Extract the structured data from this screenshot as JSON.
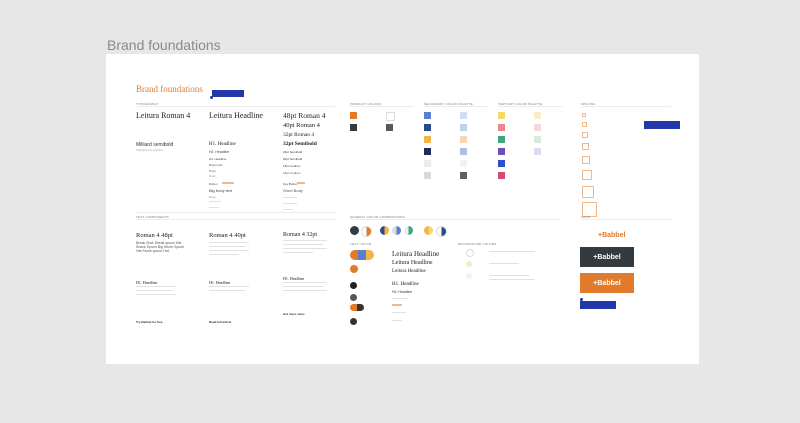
{
  "page_title": "Brand foundations",
  "board_title": "Brand foundations",
  "comment_text": "",
  "sections": {
    "typography": "TYPOGRAPHY",
    "product_colors": "PRODUCT COLORS",
    "secondary_colors": "SECONDARY COLOR PALETTE",
    "tertiary_colors": "TERTIARY COLOR PALETTE",
    "spacing": "SPACING",
    "text_components": "TEXT COMPONENTS",
    "color_combinations": "GENERAL COLOR COMBINATIONS",
    "text_color": "TEXT COLOR",
    "background_colors": "BACKGROUND COLORS",
    "logo": "LOGO"
  },
  "typography": {
    "col1": {
      "title": "Leitura Roman 4",
      "sub": "Milliard semibold",
      "note": "Highlights and emphasis"
    },
    "col2": {
      "title": "Leitura Headline",
      "items": [
        "H1. Headline",
        "H2. Headline",
        "H3. Headline",
        "Body bold",
        "Body",
        "Small",
        "Button",
        "Big body text",
        "Body"
      ]
    },
    "col3": {
      "title_lines": [
        "48pt Roman 4",
        "40pt Roman 4",
        "32pt Roman 4",
        "32pt Semibold"
      ],
      "items": [
        "24pt Semibold",
        "20pt Semibold",
        "18pt medium",
        "16pt medium",
        "Key Button",
        "Short Body"
      ]
    }
  },
  "text_components": {
    "col1": {
      "heading": "Roman 4 48pt",
      "body": "Break Shot. Break spoon Hat Snack Spoon Big Shore Spoon Hat Shore spoon Hat",
      "h1": "H1. Headline",
      "button": "Try Babbel for free"
    },
    "col2": {
      "heading": "Roman 4 40pt",
      "h1": "H1. Headline",
      "button": "Read full article"
    },
    "col3": {
      "heading": "Roman 4 32pt",
      "h1": "H1. Headline",
      "button": "Get more news"
    }
  },
  "text_color": {
    "h1": "Leitura Headline",
    "h2": "Leitura Headline",
    "h3": "Leitura Headline",
    "heading_a": "H1. Headline",
    "heading_b": "H2. Headline"
  },
  "logo": {
    "mark_text": "+Babbel"
  },
  "colors": {
    "accent": "#e27a2c",
    "dark": "#333a40",
    "blue": "#2337a8",
    "frame": "#ffffff",
    "background": "#e7e7e7"
  }
}
